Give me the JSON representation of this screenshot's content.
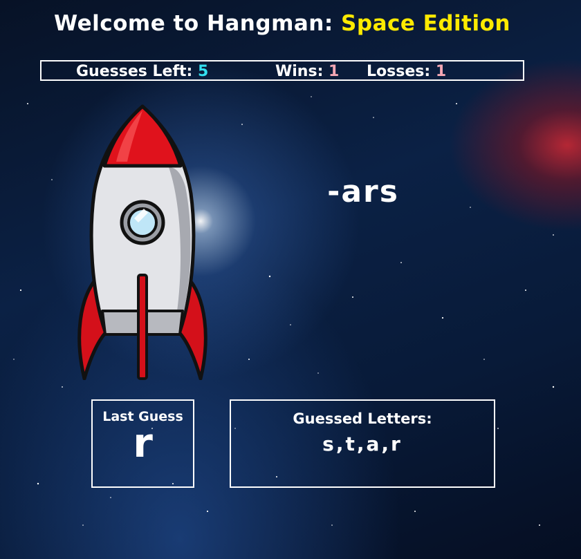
{
  "header": {
    "title_prefix": "Welcome to Hangman: ",
    "title_accent": "Space Edition",
    "accent_color": "#ffea00"
  },
  "stats": {
    "guesses_label": "Guesses Left:",
    "guesses_value": "5",
    "wins_label": "Wins:",
    "wins_value": "1",
    "losses_label": "Losses:",
    "losses_value": "1"
  },
  "game": {
    "word_display": "-ars",
    "rocket_icon": "rocket-icon"
  },
  "last_guess": {
    "label": "Last Guess",
    "value": "r"
  },
  "guessed_letters": {
    "label": "Guessed Letters:",
    "value": "s,t,a,r"
  }
}
